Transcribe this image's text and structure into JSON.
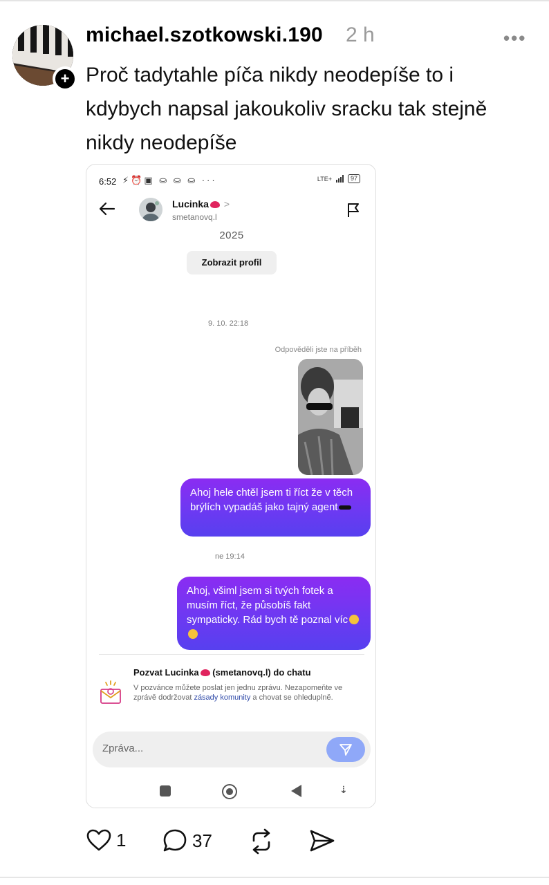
{
  "post": {
    "username": "michael.szotkowski.190",
    "time": "2 h",
    "more_label": "•••",
    "follow_symbol": "+",
    "text": "Proč tadytahle píča nikdy neodepíše to i kdybych napsal jakoukoliv sracku tak stejně nikdy neodepíše"
  },
  "screenshot": {
    "status_bar": {
      "time": "6:52",
      "icons": "⚡⏰▣ ⛀ ⛀ ⛀ ···",
      "network": "LTE+",
      "battery": "97"
    },
    "header": {
      "name": "Lucinka",
      "chevron": ">",
      "handle": "smetanovq.l"
    },
    "year": "2025",
    "profile_button": "Zobrazit profil",
    "timestamp_1": "9. 10. 22:18",
    "replied_label": "Odpověděli jste na příběh",
    "message_1": "Ahoj hele chtěl jsem ti říct že v těch brýlích vypadáš jako tajný agent",
    "timestamp_2": "ne 19:14",
    "message_2": "Ahoj, všiml jsem si tvých fotek a musím říct, že působíš fakt sympaticky. Rád bych tě poznal víc",
    "invite": {
      "title_prefix": "Pozvat Lucinka",
      "title_suffix": " (smetanovq.l) do chatu",
      "body_prefix": "V pozvánce můžete poslat jen jednu zprávu. Nezapomeňte ve zprávě dodržovat ",
      "link": "zásady komunity",
      "body_suffix": " a chovat se ohleduplně."
    },
    "composer_placeholder": "Zpráva..."
  },
  "actions": {
    "likes": "1",
    "comments": "37"
  },
  "colors": {
    "bubble_gradient": [
      "#8b2cf2",
      "#5740ef"
    ],
    "send_button": "#8fa8f8",
    "link": "#2f4aa8"
  }
}
